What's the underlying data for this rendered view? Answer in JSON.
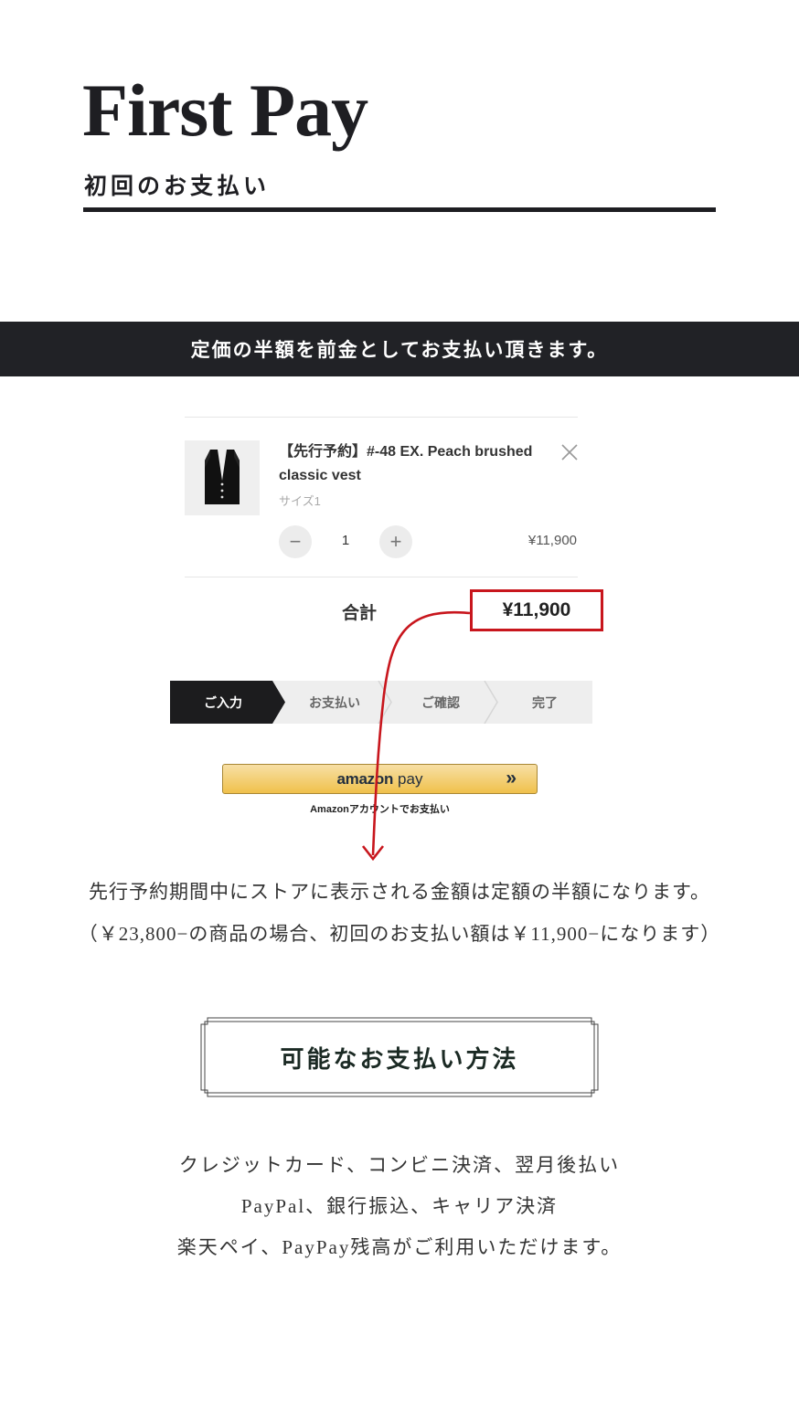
{
  "header": {
    "title": "First Pay",
    "subtitle": "初回のお支払い"
  },
  "banner": {
    "text": "定価の半額を前金としてお支払い頂きます。"
  },
  "cart": {
    "item": {
      "name": "【先行予約】#-48 EX. Peach brushed classic vest",
      "variant": "サイズ1",
      "quantity": "1",
      "price": "¥11,900",
      "minus_label": "−",
      "plus_label": "+"
    },
    "total_label": "合計",
    "total_value": "¥11,900"
  },
  "steps": [
    "ご入力",
    "お支払い",
    "ご確認",
    "完了"
  ],
  "amazon_pay": {
    "brand": "amazon",
    "pay_word": "pay",
    "arrows": "»",
    "caption": "Amazonアカウントでお支払い"
  },
  "notes": {
    "line1": "先行予約期間中にストアに表示される金額は定額の半額になります。",
    "line2": "（￥23,800−の商品の場合、初回のお支払い額は￥11,900−になります）"
  },
  "methods": {
    "heading": "可能なお支払い方法",
    "lines": [
      "クレジットカード、コンビニ決済、翌月後払い",
      "PayPal、銀行振込、キャリア決済",
      "楽天ペイ、PayPay残高がご利用いただけます。"
    ]
  },
  "colors": {
    "dark": "#212226",
    "accent_red": "#c8161d",
    "amazon_gold": "#f0c14b"
  }
}
